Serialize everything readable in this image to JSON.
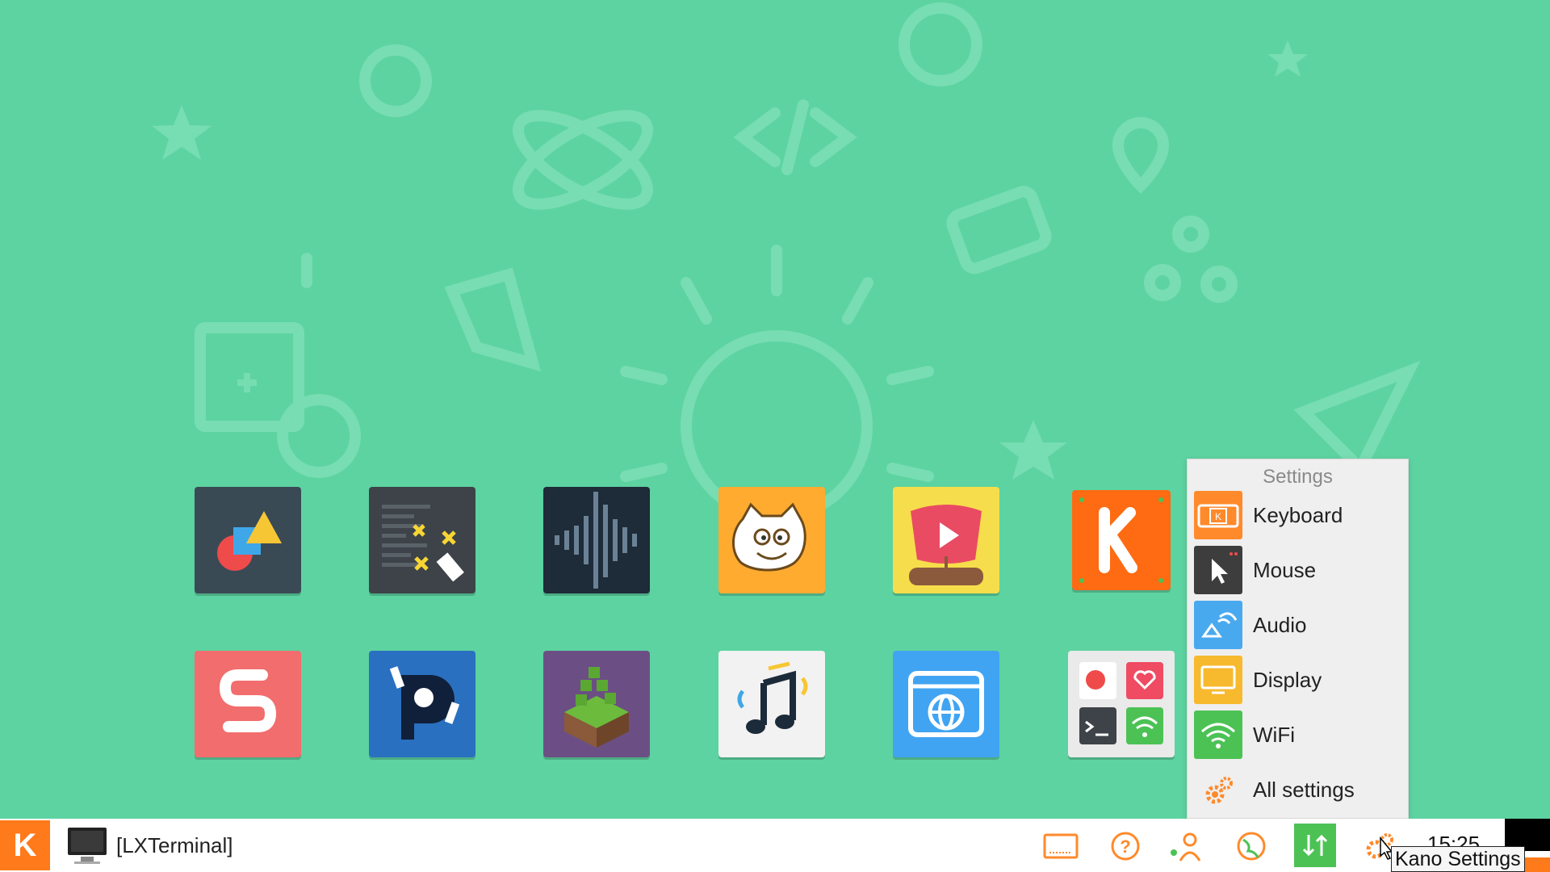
{
  "desktop": {
    "background_color": "#5dd3a1",
    "apps_row1": [
      {
        "icon": "shapes-app-icon",
        "bg": "#3a4a55"
      },
      {
        "icon": "code-editor-app-icon",
        "bg": "#3d4348"
      },
      {
        "icon": "sound-wave-app-icon",
        "bg": "#1e2b38"
      },
      {
        "icon": "scratch-cat-app-icon",
        "bg": "#ffab30"
      },
      {
        "icon": "video-app-icon",
        "bg": "#f6dd4b"
      },
      {
        "icon": "kano-app-icon",
        "bg": "#ff6b12"
      }
    ],
    "apps_row2": [
      {
        "icon": "snake-app-icon",
        "bg": "#f26d6d"
      },
      {
        "icon": "pong-app-icon",
        "bg": "#2a70c0"
      },
      {
        "icon": "minecraft-app-icon",
        "bg": "#6b4f84"
      },
      {
        "icon": "music-app-icon",
        "bg": "#f2f2f2"
      },
      {
        "icon": "browser-app-icon",
        "bg": "#41a4f2"
      },
      {
        "icon": "extras-folder-app-icon",
        "bg": "#eaeaea"
      }
    ]
  },
  "settings_menu": {
    "title": "Settings",
    "items": [
      {
        "label": "Keyboard",
        "icon": "keyboard-icon",
        "color": "#ff8a2b"
      },
      {
        "label": "Mouse",
        "icon": "mouse-pointer-icon",
        "color": "#3d3d3d"
      },
      {
        "label": "Audio",
        "icon": "speaker-icon",
        "color": "#49a9ef"
      },
      {
        "label": "Display",
        "icon": "monitor-icon",
        "color": "#f7b92e"
      },
      {
        "label": "WiFi",
        "icon": "wifi-icon",
        "color": "#4cc255"
      },
      {
        "label": "All settings",
        "icon": "gears-icon",
        "color": "#ff8a2b"
      }
    ]
  },
  "taskbar": {
    "start_label": "K",
    "task_label": "[LXTerminal]",
    "clock": "15:25",
    "tooltip": "Kano Settings",
    "tray_icons": [
      "screen-icon",
      "help-icon",
      "user-icon",
      "globe-icon",
      "updates-icon",
      "settings-gear-icon"
    ]
  },
  "colors": {
    "accent": "#ff7a1a",
    "green": "#4cc255"
  }
}
